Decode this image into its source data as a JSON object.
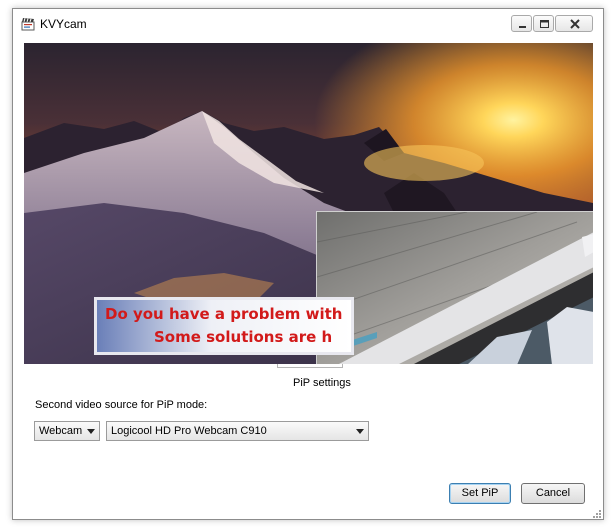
{
  "window": {
    "title": "KVYcam",
    "app_icon": "clapperboard-icon"
  },
  "title_buttons": {
    "minimize": "minimize-icon",
    "maximize": "maximize-icon",
    "close": "close-icon"
  },
  "video": {
    "banner_line1": "Do you have a problem with",
    "banner_line2": "Some solutions are h"
  },
  "pip_settings": {
    "section_label": "PiP settings",
    "source_label": "Second video source for PiP mode:",
    "source_type": {
      "selected": "Webcam"
    },
    "device": {
      "selected": "Logicool HD Pro Webcam C910"
    }
  },
  "buttons": {
    "set_pip": "Set PiP",
    "cancel": "Cancel"
  },
  "colors": {
    "banner_text": "#d21a1a",
    "default_button_border": "#3c7fb1"
  }
}
